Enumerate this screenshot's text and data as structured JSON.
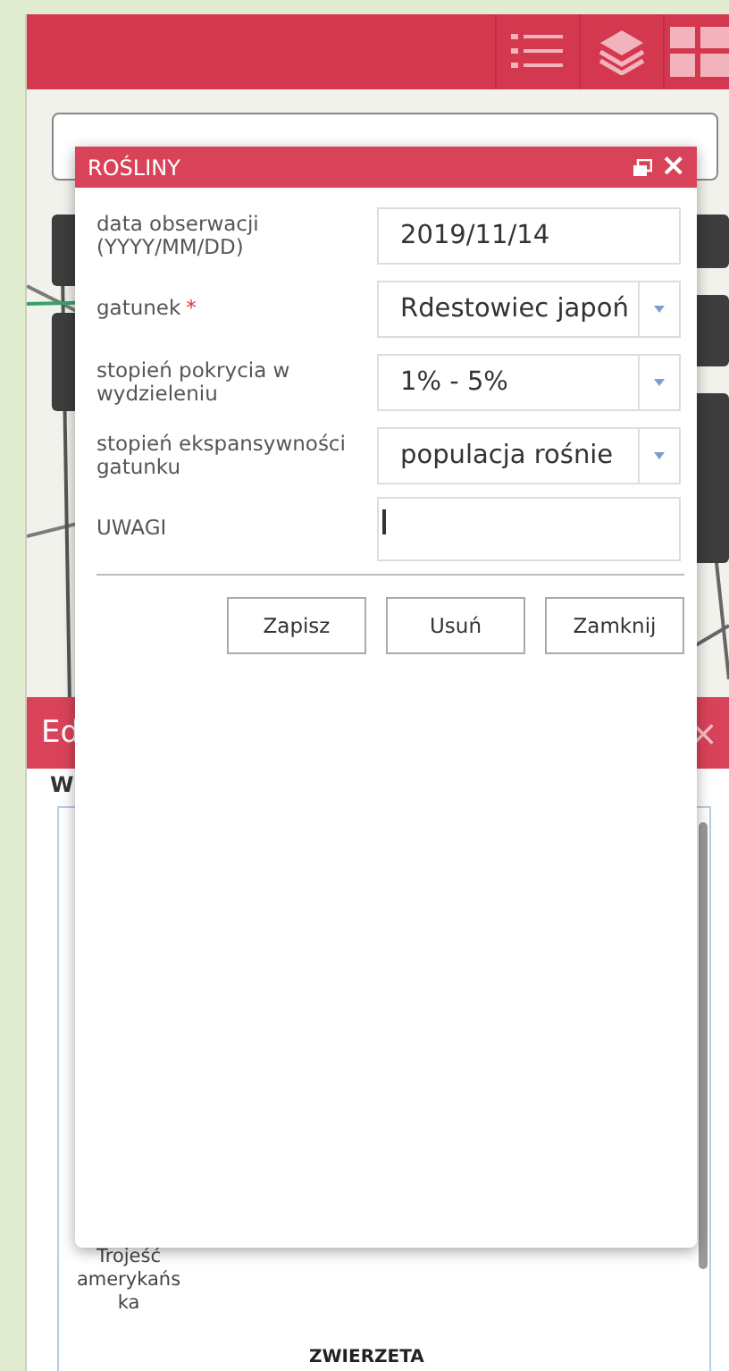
{
  "back_panel": {
    "title": "Ed",
    "close": "×",
    "subtitle": "W",
    "item_label": "Trojeść amerykańska",
    "section": "ZWIERZETA"
  },
  "dialog": {
    "title": "ROŚLINY",
    "close": "×",
    "fields": [
      {
        "kind": "text",
        "label": "data obserwacji (YYYY/MM/DD)",
        "value": "2019/11/14"
      },
      {
        "kind": "select",
        "label": "gatunek",
        "required_mark": "*",
        "value": "Rdestowiec japoń"
      },
      {
        "kind": "select",
        "label": "stopień pokrycia w wydzieleniu",
        "value": "1% - 5%"
      },
      {
        "kind": "select",
        "label": "stopień ekspansywności gatunku",
        "value": "populacja rośnie"
      },
      {
        "kind": "textarea",
        "label": "UWAGI"
      }
    ],
    "buttons": [
      "Zapisz",
      "Usuń",
      "Zamknij"
    ]
  }
}
